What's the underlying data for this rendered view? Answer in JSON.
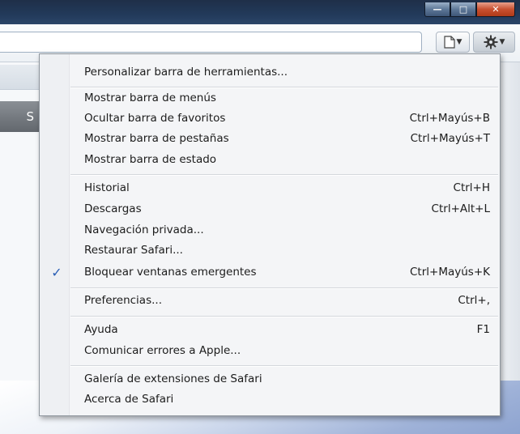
{
  "window": {
    "minimize_glyph": "—",
    "maximize_glyph": "□",
    "close_glyph": "✕"
  },
  "toolbar": {
    "address_value": "",
    "page_icon": "page-icon",
    "gear_icon": "gear-icon"
  },
  "background": {
    "side_tab_letter": "S"
  },
  "menu": {
    "items": [
      {
        "label": "Personalizar barra de herramientas...",
        "shortcut": "",
        "checked": false
      },
      {
        "label": "Mostrar barra de menús",
        "shortcut": "",
        "checked": false
      },
      {
        "label": "Ocultar barra de favoritos",
        "shortcut": "Ctrl+Mayús+B",
        "checked": false
      },
      {
        "label": "Mostrar barra de pestañas",
        "shortcut": "Ctrl+Mayús+T",
        "checked": false
      },
      {
        "label": "Mostrar barra de estado",
        "shortcut": "",
        "checked": false
      },
      {
        "label": "Historial",
        "shortcut": "Ctrl+H",
        "checked": false
      },
      {
        "label": "Descargas",
        "shortcut": "Ctrl+Alt+L",
        "checked": false
      },
      {
        "label": "Navegación privada...",
        "shortcut": "",
        "checked": false
      },
      {
        "label": "Restaurar Safari...",
        "shortcut": "",
        "checked": false
      },
      {
        "label": "Bloquear ventanas emergentes",
        "shortcut": "Ctrl+Mayús+K",
        "checked": true
      },
      {
        "label": "Preferencias...",
        "shortcut": "Ctrl+,",
        "checked": false
      },
      {
        "label": "Ayuda",
        "shortcut": "F1",
        "checked": false
      },
      {
        "label": "Comunicar errores a Apple...",
        "shortcut": "",
        "checked": false
      },
      {
        "label": "Galería de extensiones de Safari",
        "shortcut": "",
        "checked": false
      },
      {
        "label": "Acerca de Safari",
        "shortcut": "",
        "checked": false
      }
    ],
    "check_glyph": "✓"
  }
}
